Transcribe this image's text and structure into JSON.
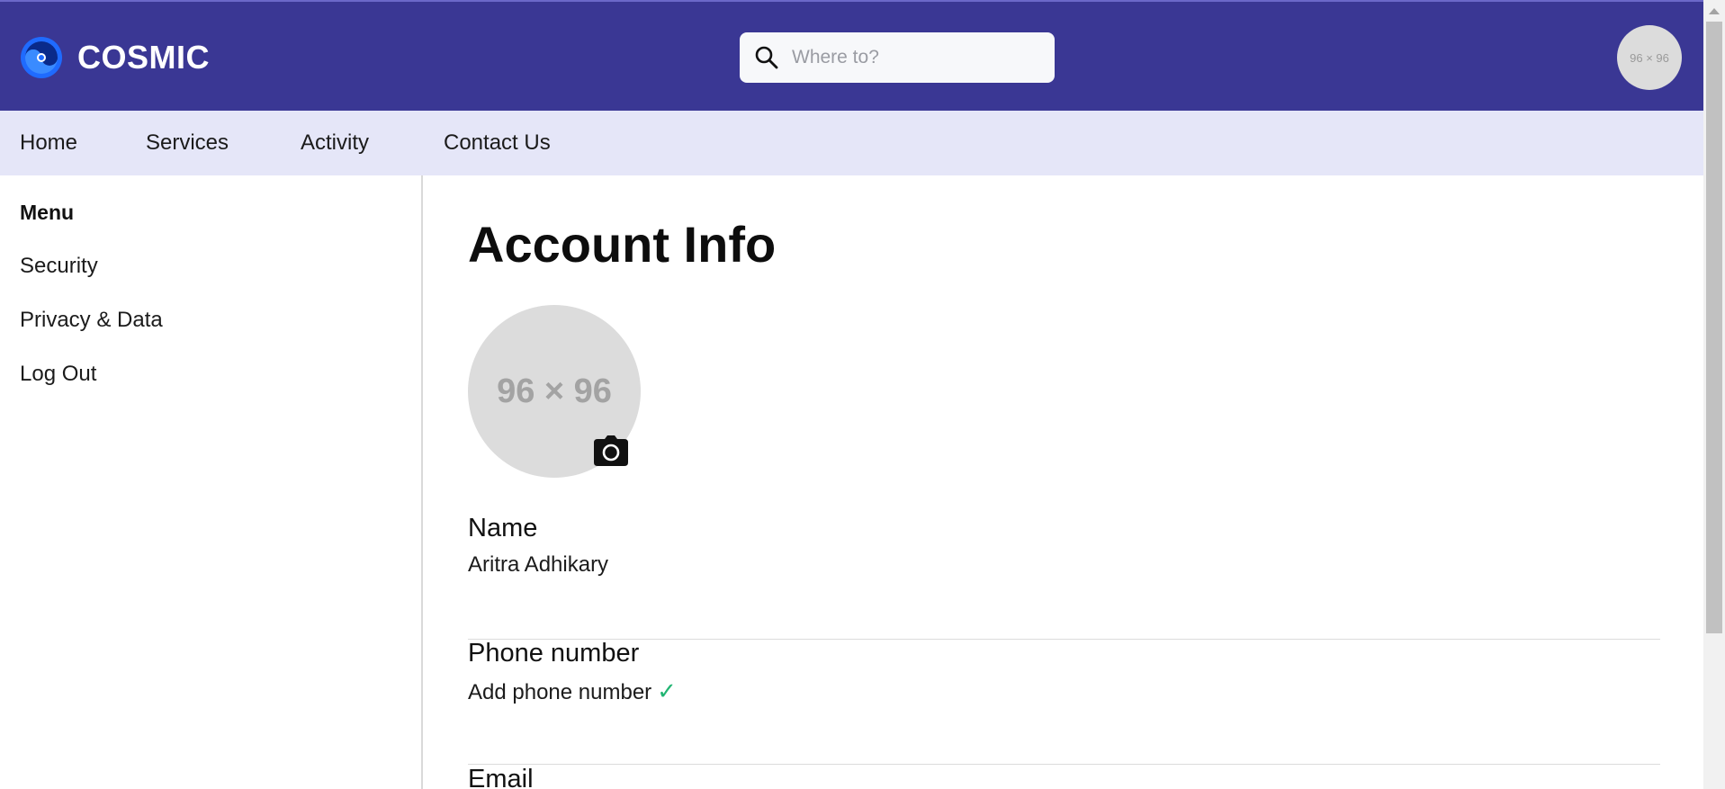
{
  "brand": {
    "name": "COSMIC",
    "logo_icon": "cosmic-swirl-logo",
    "accent": "#1f6bff"
  },
  "header": {
    "background": "#3a3794",
    "search": {
      "placeholder": "Where to?",
      "value": "",
      "icon": "search-icon"
    },
    "avatar_text": "96 × 96"
  },
  "nav": {
    "items": [
      {
        "label": "Home"
      },
      {
        "label": "Services"
      },
      {
        "label": "Activity"
      },
      {
        "label": "Contact Us"
      }
    ]
  },
  "sidebar": {
    "heading": "Menu",
    "items": [
      {
        "label": "Security"
      },
      {
        "label": "Privacy & Data"
      },
      {
        "label": "Log Out"
      }
    ]
  },
  "main": {
    "title": "Account Info",
    "profile_photo_text": "96 × 96",
    "camera_icon": "camera-icon",
    "fields": {
      "name": {
        "label": "Name",
        "value": "Aritra Adhikary"
      },
      "phone": {
        "label": "Phone number",
        "value": "Add phone number",
        "status_icon": "✓",
        "status_color": "#22b573"
      },
      "email": {
        "label": "Email"
      }
    }
  }
}
